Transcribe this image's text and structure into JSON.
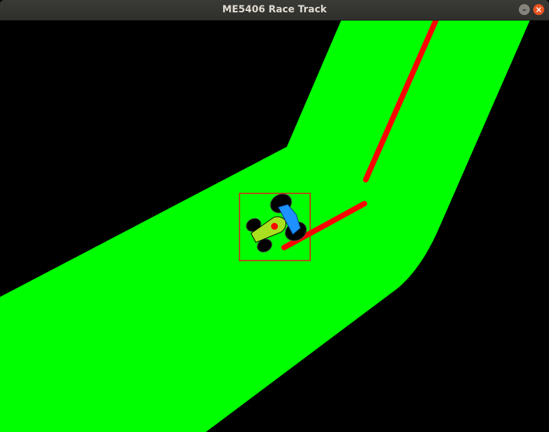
{
  "window": {
    "title": "ME5406 Race Track",
    "controls": {
      "minimize_glyph": "–",
      "close_glyph": "×"
    }
  },
  "colors": {
    "background": "#000000",
    "track": "#00ff00",
    "path": "#ff0000",
    "car_body": "#a8e020",
    "car_spoiler": "#1e90ff",
    "wheels": "#000000",
    "bounding_box": "#ff2020"
  }
}
